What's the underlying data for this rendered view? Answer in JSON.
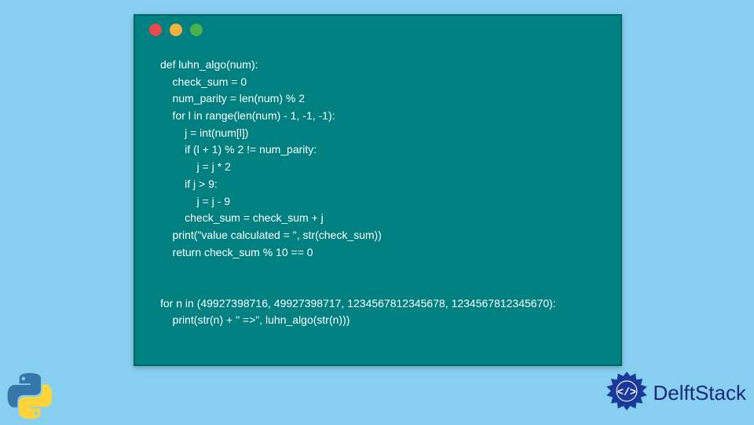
{
  "code": "def luhn_algo(num):\n    check_sum = 0\n    num_parity = len(num) % 2\n    for l in range(len(num) - 1, -1, -1):\n        j = int(num[l])\n        if (l + 1) % 2 != num_parity:\n            j = j * 2\n        if j > 9:\n            j = j - 9\n        check_sum = check_sum + j\n    print(\"value calculated = \", str(check_sum))\n    return check_sum % 10 == 0\n\n\nfor n in (49927398716, 49927398717, 1234567812345678, 1234567812345670):\n    print(str(n) + \" =>\", luhn_algo(str(n)))",
  "brand": {
    "name": "DelftStack"
  },
  "window": {
    "dots": [
      "red",
      "yellow",
      "green"
    ]
  }
}
